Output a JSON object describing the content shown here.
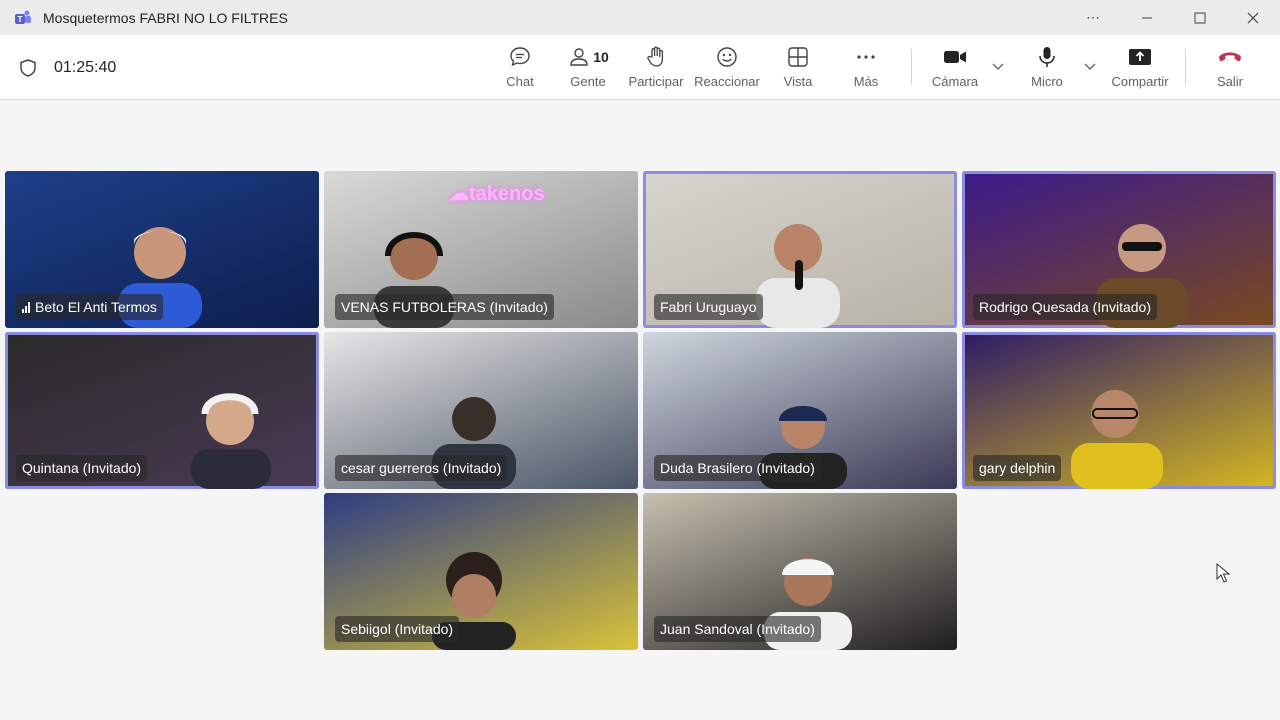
{
  "window": {
    "title": "Mosquetermos FABRI NO LO FILTRES"
  },
  "meeting": {
    "timer": "01:25:40"
  },
  "toolbar": {
    "chat": {
      "label": "Chat",
      "icon": "chat-icon"
    },
    "people": {
      "label": "Gente",
      "count": "10",
      "icon": "people-icon"
    },
    "raise": {
      "label": "Participar",
      "icon": "raise-hand-icon"
    },
    "react": {
      "label": "Reaccionar",
      "icon": "smiley-icon"
    },
    "view": {
      "label": "Vista",
      "icon": "grid-icon"
    },
    "more": {
      "label": "Más",
      "icon": "more-icon"
    },
    "camera": {
      "label": "Cámara",
      "icon": "camera-icon"
    },
    "mic": {
      "label": "Micro",
      "icon": "mic-icon"
    },
    "share": {
      "label": "Compartir",
      "icon": "share-icon"
    },
    "leave": {
      "label": "Salir",
      "icon": "hangup-icon",
      "color": "#c4314b"
    }
  },
  "participants": [
    {
      "name": "Beto El Anti Termos",
      "speaking_indicator": true,
      "bg": "#1e3f8a",
      "bg2": "#0d1f4d"
    },
    {
      "name": "VENAS FUTBOLERAS (Invitado)",
      "bg": "#d9d9d9",
      "bg2": "#8a8a8a"
    },
    {
      "name": "Fabri Uruguayo",
      "bg": "#d7d5cf",
      "bg2": "#b8b2a6"
    },
    {
      "name": "Rodrigo Quesada (Invitado)",
      "bg": "#3b1a8c",
      "bg2": "#7a4a1f"
    },
    {
      "name": "Quintana (Invitado)",
      "bg": "#2a2a2a",
      "bg2": "#4a3a55"
    },
    {
      "name": "cesar guerreros (Invitado)",
      "bg": "#e6e6e6",
      "bg2": "#4a5566"
    },
    {
      "name": "Duda Brasilero (Invitado)",
      "bg": "#cfd6de",
      "bg2": "#3a3a55"
    },
    {
      "name": "gary delphin",
      "bg": "#2c1a66",
      "bg2": "#d6b822"
    },
    {
      "name": "Sebiigol (Invitado)",
      "bg": "#2e3d82",
      "bg2": "#d9c33a"
    },
    {
      "name": "Juan Sandoval (Invitado)",
      "bg": "#c7c0b0",
      "bg2": "#1f1f1f"
    }
  ],
  "colors": {
    "accent": "#8b8ce0",
    "leave": "#c4314b"
  }
}
